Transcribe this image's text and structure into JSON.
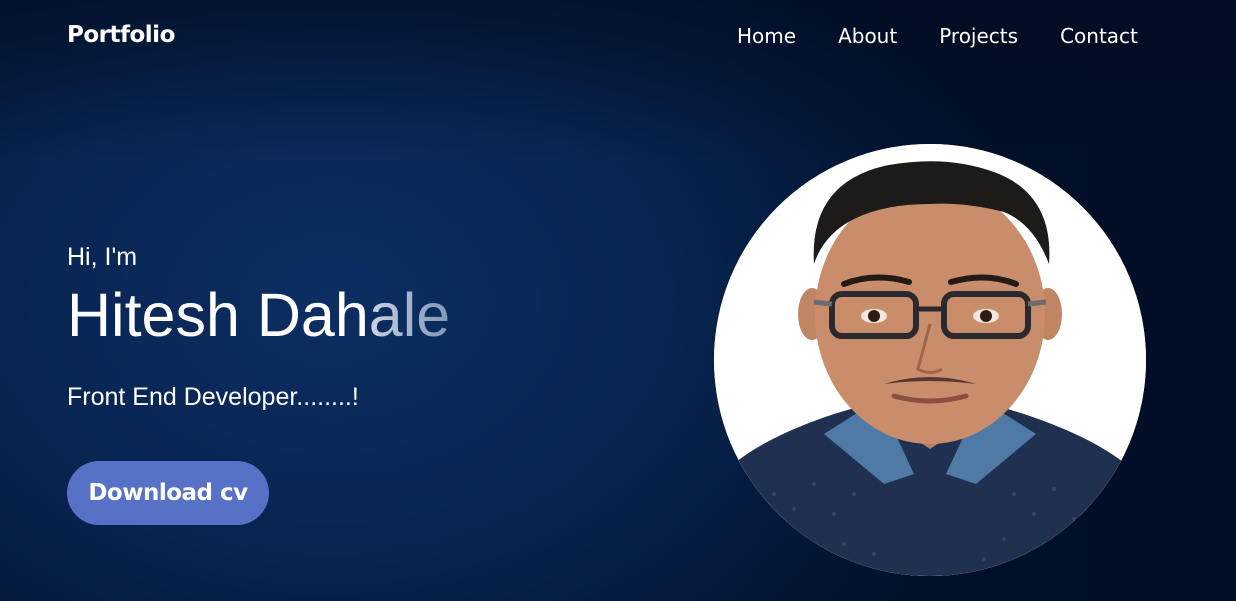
{
  "header": {
    "logo": "Portfolio",
    "nav": [
      "Home",
      "About",
      "Projects",
      "Contact"
    ]
  },
  "hero": {
    "greeting": "Hi, I'm",
    "name_typed": "Hitesh Dah",
    "name_fading": "ale",
    "role": "Front End Developer........!",
    "cta_label": "Download cv"
  },
  "colors": {
    "background": "#082552",
    "button": "#5671c6",
    "text": "#ffffff"
  },
  "icons": {
    "profile_photo": "profile-photo"
  }
}
